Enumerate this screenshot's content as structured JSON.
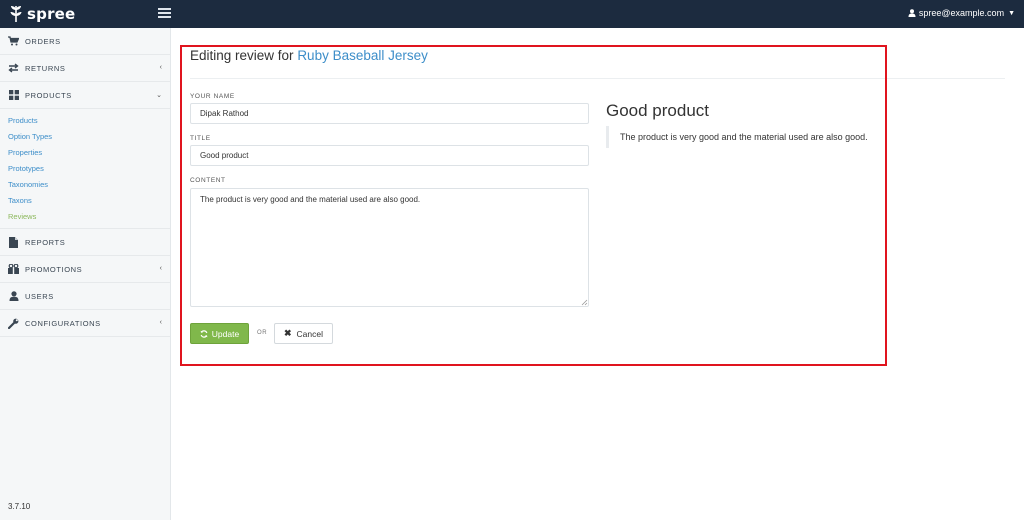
{
  "brand": {
    "name": "spree"
  },
  "header": {
    "user_email": "spree@example.com"
  },
  "sidebar": {
    "items": [
      {
        "label": "ORDERS",
        "icon": "cart-icon"
      },
      {
        "label": "RETURNS",
        "icon": "exchange-icon"
      },
      {
        "label": "PRODUCTS",
        "icon": "grid-icon"
      },
      {
        "label": "REPORTS",
        "icon": "file-icon"
      },
      {
        "label": "PROMOTIONS",
        "icon": "gift-icon"
      },
      {
        "label": "USERS",
        "icon": "user-icon"
      },
      {
        "label": "CONFIGURATIONS",
        "icon": "wrench-icon"
      }
    ],
    "product_subitems": [
      "Products",
      "Option Types",
      "Properties",
      "Prototypes",
      "Taxonomies",
      "Taxons",
      "Reviews"
    ],
    "active_subitem": "Reviews",
    "version": "3.7.10"
  },
  "page": {
    "title_prefix": "Editing review for",
    "product_name": "Ruby Baseball Jersey"
  },
  "form": {
    "name_label": "YOUR NAME",
    "name_value": "Dipak Rathod",
    "title_label": "TITLE",
    "title_value": "Good product",
    "content_label": "CONTENT",
    "content_value": "The product is very good and the material used are also good.",
    "update_label": "Update",
    "or_label": "OR",
    "cancel_label": "Cancel"
  },
  "preview": {
    "title": "Good product",
    "content": "The product is very good and the material used are also good."
  },
  "colors": {
    "topbar": "#1c2b3f",
    "link": "#3d8ec9",
    "active_link": "#8cb85c",
    "update_button": "#80b84b",
    "highlight": "#e0141e"
  }
}
